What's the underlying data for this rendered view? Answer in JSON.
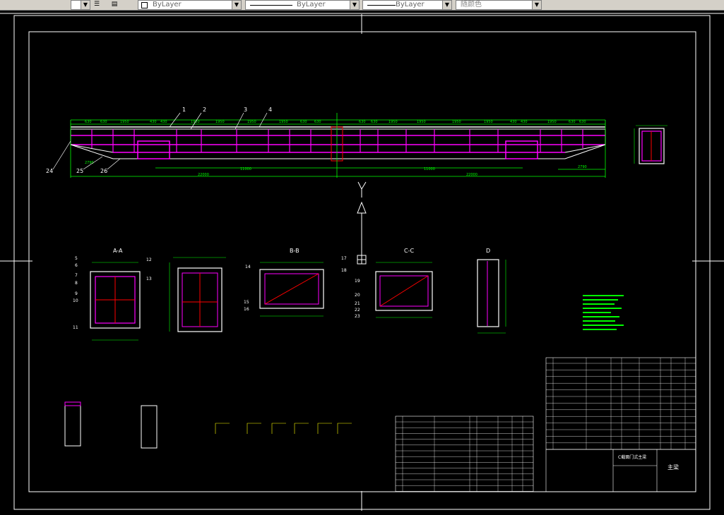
{
  "toolbar": {
    "layer_label": "ByLayer",
    "linetype_label": "ByLayer",
    "lineweight_label": "ByLayer",
    "color_label": "随颜色"
  },
  "drawing": {
    "top_labels": [
      "1",
      "2",
      "3",
      "4"
    ],
    "left_labels": [
      "24",
      "25",
      "26"
    ],
    "section_titles": [
      "A-A",
      "B-B",
      "C-C",
      "D"
    ],
    "aa_labels": [
      "5",
      "6",
      "7",
      "8",
      "9",
      "10",
      "11",
      "12",
      "13"
    ],
    "bb_labels": [
      "14",
      "15",
      "16",
      "17",
      "18"
    ],
    "cc_labels": [
      "19",
      "20",
      "21",
      "22",
      "23"
    ],
    "title_block_name": "C截面门式主梁",
    "title_block_sign": "主梁"
  }
}
